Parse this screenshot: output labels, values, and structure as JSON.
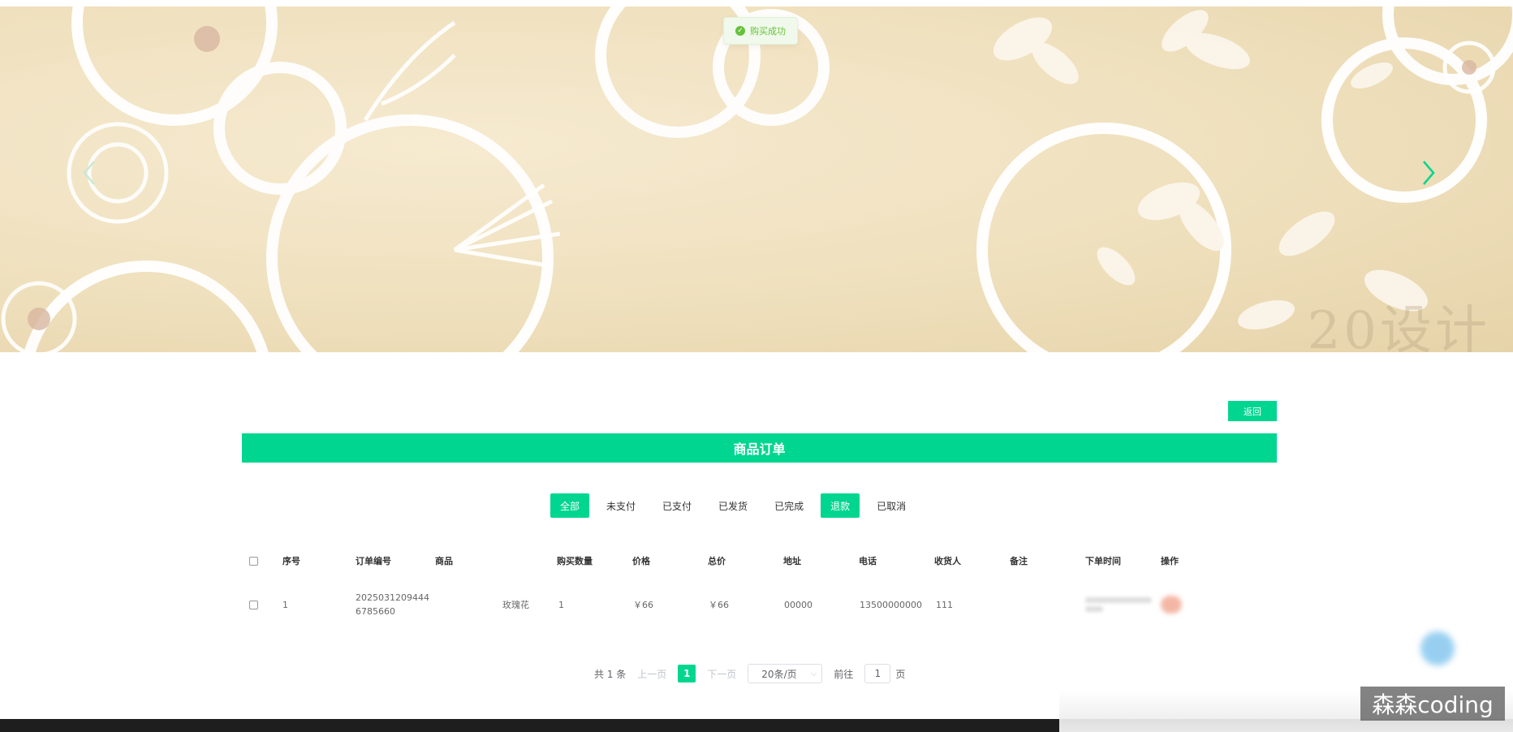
{
  "toast": {
    "text": "购买成功"
  },
  "banner": {
    "watermark": "20设计"
  },
  "actions": {
    "back_label": "返回"
  },
  "page_title": "商品订单",
  "tabs": [
    {
      "label": "全部",
      "active": true
    },
    {
      "label": "未支付",
      "active": false
    },
    {
      "label": "已支付",
      "active": false
    },
    {
      "label": "已发货",
      "active": false
    },
    {
      "label": "已完成",
      "active": false
    },
    {
      "label": "退款",
      "active": true
    },
    {
      "label": "已取消",
      "active": false
    }
  ],
  "table": {
    "headers": [
      "序号",
      "订单编号",
      "商品",
      "购买数量",
      "价格",
      "总价",
      "地址",
      "电话",
      "收货人",
      "备注",
      "下单时间",
      "操作"
    ],
    "rows": [
      {
        "index": "1",
        "order_no_line1": "2025031209444",
        "order_no_line2": "6785660",
        "product": "玫瑰花",
        "quantity": "1",
        "price": "￥66",
        "total": "￥66",
        "address": "00000",
        "phone": "13500000000",
        "receiver": "111",
        "remark": ""
      }
    ]
  },
  "pagination": {
    "total": "共 1 条",
    "prev": "上一页",
    "current": "1",
    "next": "下一页",
    "page_size": "20条/页",
    "goto_prefix": "前往",
    "goto_value": "1",
    "goto_suffix": "页"
  },
  "watermark_badge": "森森coding",
  "colors": {
    "accent": "#00d68f",
    "toast_success": "#67c23a"
  }
}
